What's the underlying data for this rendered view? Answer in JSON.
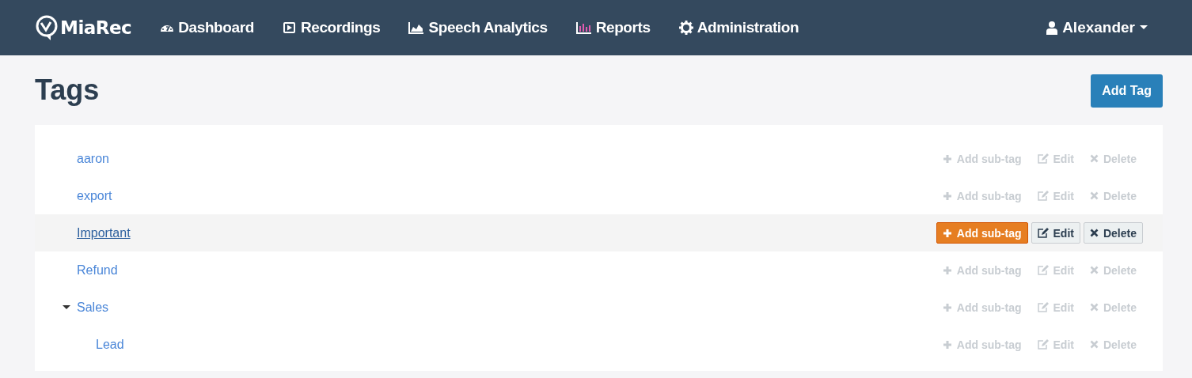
{
  "navbar": {
    "brand": "MiaRec",
    "items": [
      {
        "kind": "dashboard",
        "label": "Dashboard"
      },
      {
        "kind": "recordings",
        "label": "Recordings"
      },
      {
        "kind": "analytics",
        "label": "Speech Analytics"
      },
      {
        "kind": "reports",
        "label": "Reports"
      },
      {
        "kind": "admin",
        "label": "Administration"
      }
    ],
    "user": "Alexander"
  },
  "page": {
    "title": "Tags",
    "add_button": "Add Tag"
  },
  "tags": [
    {
      "name": "aaron",
      "hovered": false,
      "actions": [
        {
          "kind": "add",
          "label": "Add sub-tag"
        },
        {
          "kind": "edit",
          "label": "Edit"
        },
        {
          "kind": "delete",
          "label": "Delete"
        }
      ]
    },
    {
      "name": "export",
      "hovered": false,
      "actions": [
        {
          "kind": "add",
          "label": "Add sub-tag"
        },
        {
          "kind": "edit",
          "label": "Edit"
        },
        {
          "kind": "delete",
          "label": "Delete"
        }
      ]
    },
    {
      "name": "Important",
      "hovered": true,
      "actions": [
        {
          "kind": "add",
          "label": "Add sub-tag"
        },
        {
          "kind": "edit",
          "label": "Edit"
        },
        {
          "kind": "delete",
          "label": "Delete"
        }
      ]
    },
    {
      "name": "Refund",
      "hovered": false,
      "actions": [
        {
          "kind": "add",
          "label": "Add sub-tag"
        },
        {
          "kind": "edit",
          "label": "Edit"
        },
        {
          "kind": "delete",
          "label": "Delete"
        }
      ]
    },
    {
      "name": "Sales",
      "hovered": false,
      "expanded": true,
      "actions": [
        {
          "kind": "add",
          "label": "Add sub-tag"
        },
        {
          "kind": "edit",
          "label": "Edit"
        },
        {
          "kind": "delete",
          "label": "Delete"
        }
      ],
      "children": [
        {
          "name": "Lead",
          "hovered": false,
          "actions": [
            {
              "kind": "add",
              "label": "Add sub-tag"
            },
            {
              "kind": "edit",
              "label": "Edit"
            },
            {
              "kind": "delete",
              "label": "Delete"
            }
          ]
        }
      ]
    }
  ]
}
